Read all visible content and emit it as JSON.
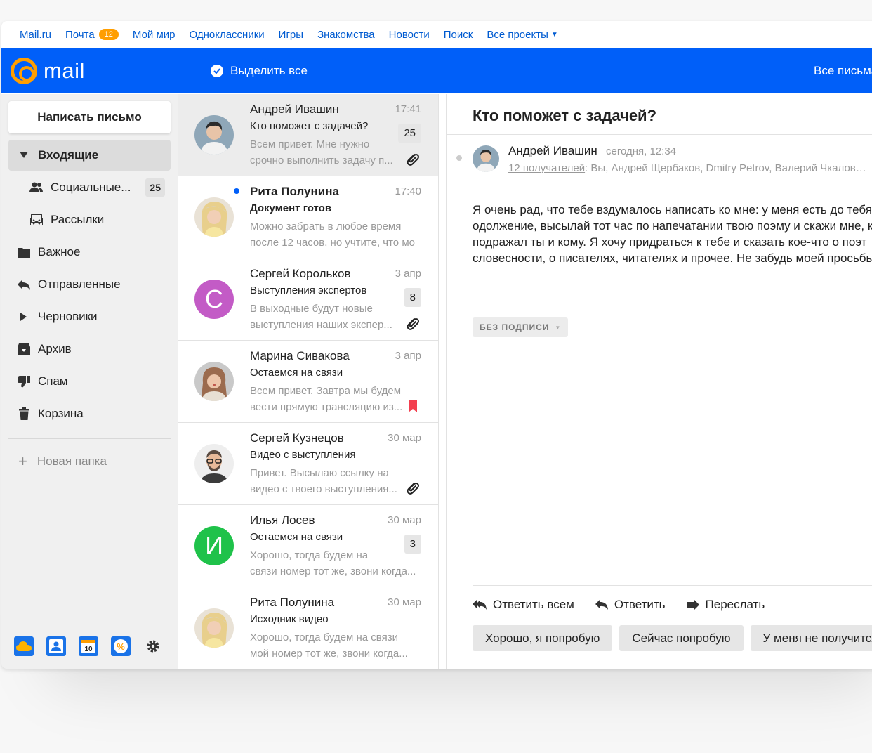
{
  "portal": {
    "items": [
      "Mail.ru",
      "Почта",
      "Мой мир",
      "Одноклассники",
      "Игры",
      "Знакомства",
      "Новости",
      "Поиск",
      "Все проекты"
    ],
    "mail_badge": "12"
  },
  "header": {
    "logo": "mail",
    "select_all": "Выделить все",
    "all_letters": "Все письма"
  },
  "sidebar": {
    "compose": "Написать письмо",
    "folders": [
      {
        "label": "Входящие",
        "icon": "caret-down-icon"
      },
      {
        "label": "Социальные...",
        "icon": "users-icon",
        "count": "25"
      },
      {
        "label": "Рассылки",
        "icon": "newsletter-icon"
      },
      {
        "label": "Важное",
        "icon": "folder-icon"
      },
      {
        "label": "Отправленные",
        "icon": "reply-arrow-icon"
      },
      {
        "label": "Черновики",
        "icon": "caret-right-icon"
      },
      {
        "label": "Архив",
        "icon": "archive-icon"
      },
      {
        "label": "Спам",
        "icon": "thumb-down-icon"
      },
      {
        "label": "Корзина",
        "icon": "trash-icon"
      }
    ],
    "new_folder": "Новая папка"
  },
  "messages": [
    {
      "sender": "Андрей Ивашин",
      "time": "17:41",
      "subject": "Кто поможет с задачей?",
      "preview1": "Всем привет. Мне нужно",
      "preview2": "срочно выполнить задачу п...",
      "badge": "25",
      "icon": "attachment-icon"
    },
    {
      "sender": "Рита Полунина",
      "time": "17:40",
      "subject": "Документ готов",
      "preview1": "Можно забрать в любое время",
      "preview2": "после 12 часов, но учтите, что мо"
    },
    {
      "sender": "Сергей Корольков",
      "time": "3 апр",
      "subject": "Выступления экспертов",
      "preview1": "В выходные будут новые",
      "preview2": "выступления наших экспер...",
      "badge": "8",
      "icon": "attachment-icon",
      "letter": "С"
    },
    {
      "sender": "Марина Сивакова",
      "time": "3 апр",
      "subject": "Остаемся на связи",
      "preview1": "Всем привет. Завтра мы будем",
      "preview2": "вести прямую трансляцию из...",
      "icon": "bookmark-icon"
    },
    {
      "sender": "Сергей Кузнецов",
      "time": "30 мар",
      "subject": "Видео с выступления",
      "preview1": "Привет. Высылаю ссылку на",
      "preview2": "видео с твоего выступления...",
      "icon": "attachment-icon"
    },
    {
      "sender": "Илья Лосев",
      "time": "30 мар",
      "subject": "Остаемся на связи",
      "preview1": "Хорошо, тогда будем на",
      "preview2": "связи номер тот же, звони когда...",
      "badge": "3",
      "letter": "И"
    },
    {
      "sender": "Рита Полунина",
      "time": "30 мар",
      "subject": "Исходник видео",
      "preview1": "Хорошо, тогда будем на связи",
      "preview2": "мой номер тот же, звони когда..."
    }
  ],
  "reader": {
    "subject": "Кто поможет с задачей?",
    "from": "Андрей Ивашин",
    "when": "сегодня, 12:34",
    "recipients_link": "12 получателей",
    "recipients": ": Вы, Андрей Щербаков, Dmitry Petrov, Валерий Чкалов…",
    "body": [
      "Я очень рад, что тебе вздумалось написать ко мне: у меня есть до тебя",
      "одолжение, высылай тот час по напечатании твою поэму и скажи мне, ко",
      "подражал ты и кому. Я хочу придраться к тебе и сказать кое-что о поэт",
      "словесности, о писателях, читателях и прочее. Не забудь моей просьбы"
    ],
    "signature": "БЕЗ ПОДПИСИ",
    "actions": [
      "Ответить всем",
      "Ответить",
      "Переслать"
    ],
    "quick_replies": [
      "Хорошо, я попробую",
      "Сейчас попробую",
      "У меня не получится"
    ]
  },
  "colors": {
    "brand_blue": "#005ff9",
    "link_blue": "#005bd1",
    "badge_orange": "#ff9e00"
  }
}
